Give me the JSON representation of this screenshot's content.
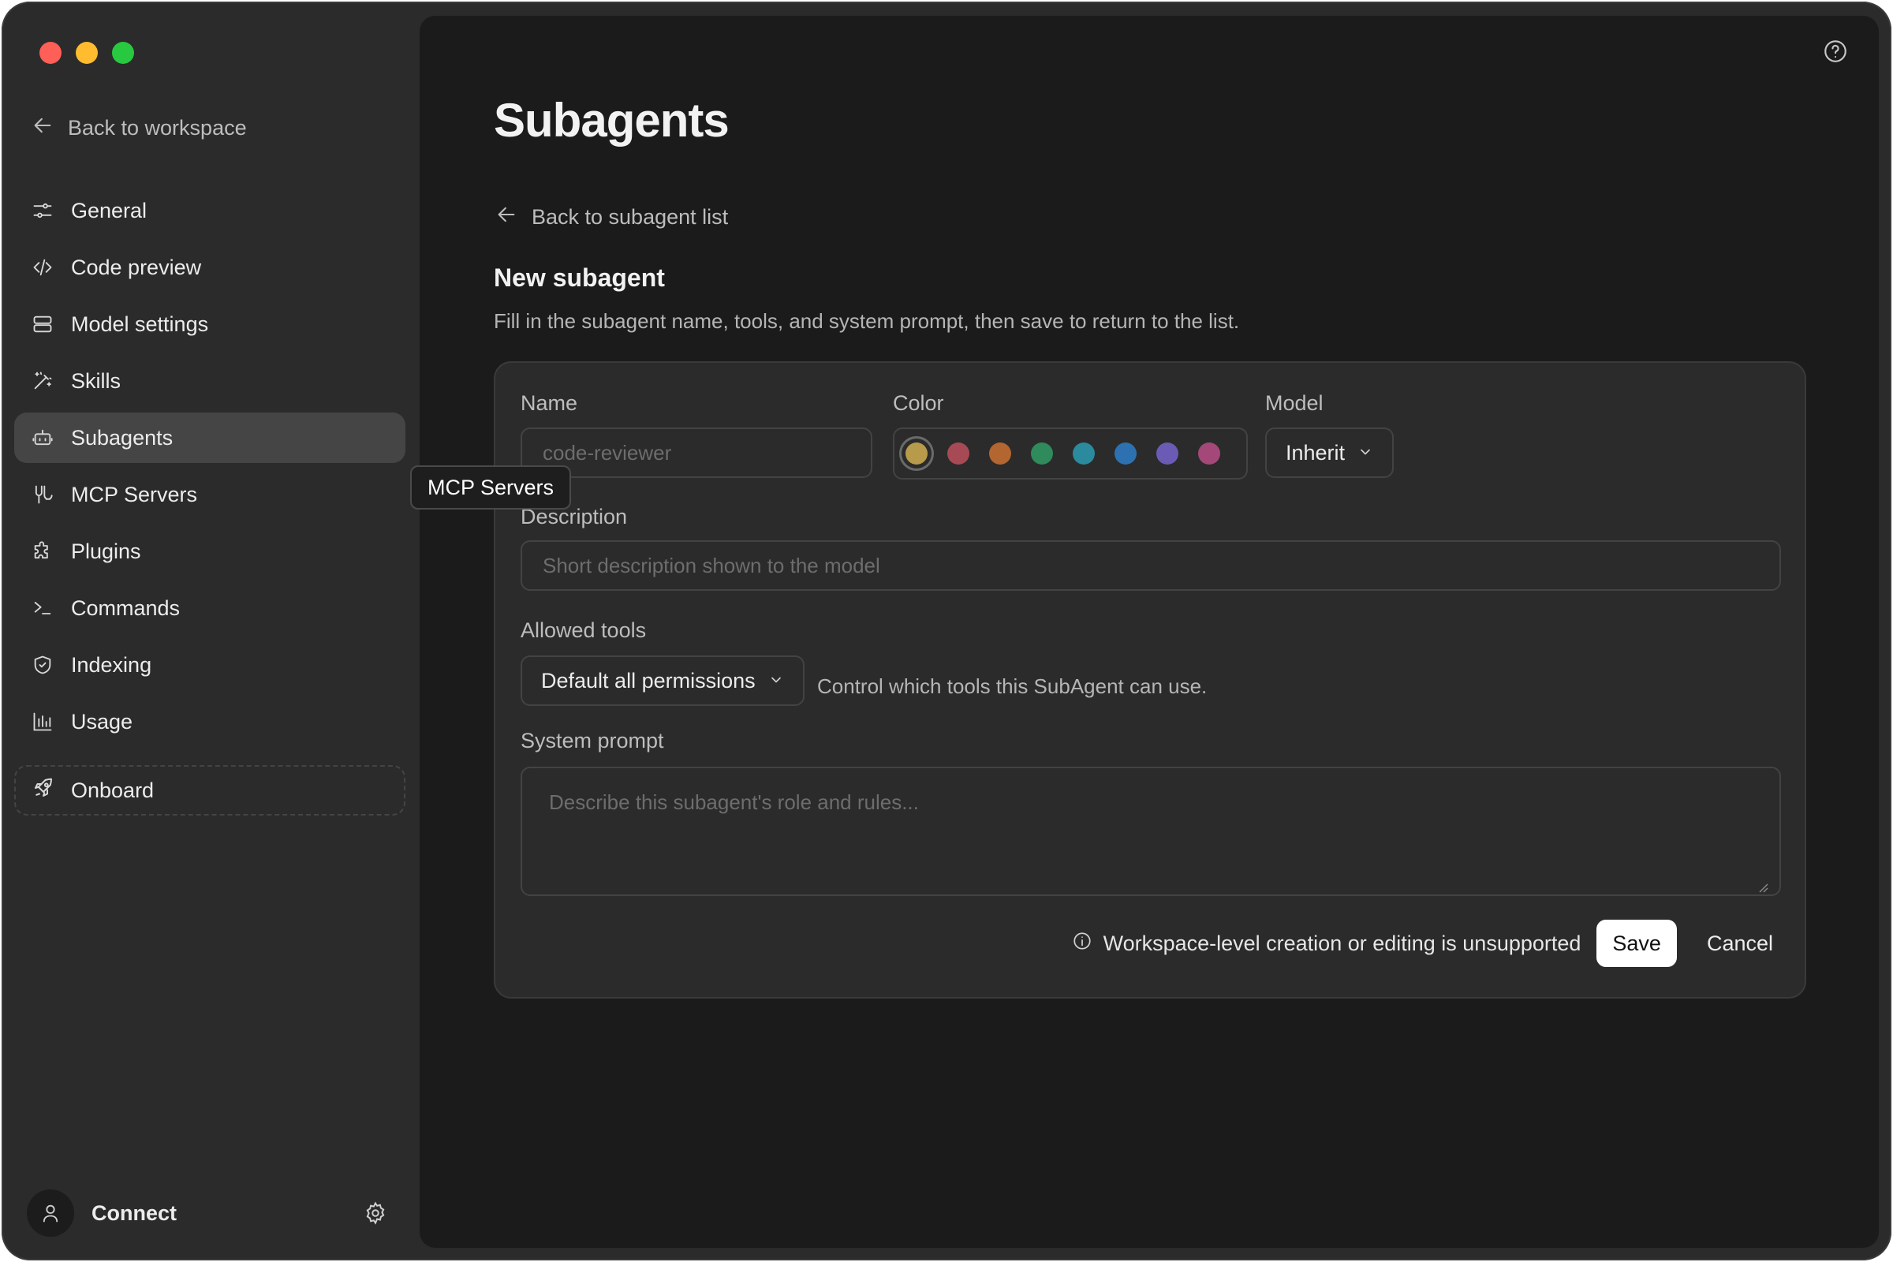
{
  "sidebar": {
    "back_label": "Back to workspace",
    "items": [
      {
        "label": "General",
        "icon": "sliders-icon"
      },
      {
        "label": "Code preview",
        "icon": "code-icon"
      },
      {
        "label": "Model settings",
        "icon": "server-icon"
      },
      {
        "label": "Skills",
        "icon": "wand-icon"
      },
      {
        "label": "Subagents",
        "icon": "bot-icon",
        "active": true
      },
      {
        "label": "MCP Servers",
        "icon": "mcp-icon"
      },
      {
        "label": "Plugins",
        "icon": "puzzle-icon"
      },
      {
        "label": "Commands",
        "icon": "terminal-icon"
      },
      {
        "label": "Indexing",
        "icon": "shield-icon"
      },
      {
        "label": "Usage",
        "icon": "bar-chart-icon"
      }
    ],
    "onboard_label": "Onboard",
    "account_label": "Connect"
  },
  "tooltip": "MCP Servers",
  "main": {
    "title": "Subagents",
    "back_label": "Back to subagent list",
    "section_title": "New subagent",
    "section_desc": "Fill in the subagent name, tools, and system prompt, then save to return to the list."
  },
  "form": {
    "name_label": "Name",
    "name_placeholder": "code-reviewer",
    "color_label": "Color",
    "colors": [
      "#b89b4a",
      "#a84a55",
      "#b3662f",
      "#2f8a5c",
      "#2b8a9e",
      "#2d71b0",
      "#6b5bb5",
      "#a4487a"
    ],
    "model_label": "Model",
    "model_value": "Inherit",
    "description_label": "Description",
    "description_placeholder": "Short description shown to the model",
    "tools_label": "Allowed tools",
    "tools_value": "Default all permissions",
    "tools_hint": "Control which tools this SubAgent can use.",
    "prompt_label": "System prompt",
    "prompt_placeholder": "Describe this subagent's role and rules...",
    "notice": "Workspace-level creation or editing is unsupported",
    "save_label": "Save",
    "cancel_label": "Cancel"
  }
}
